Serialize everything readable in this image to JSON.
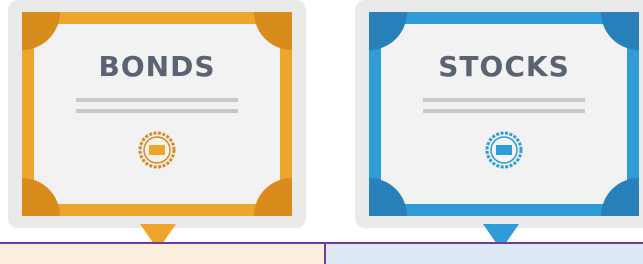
{
  "bonds": {
    "title": "BONDS",
    "colors": {
      "border": "#efa52b",
      "corner": "#d98c1c",
      "seal": "#d88a1f",
      "seal_fill": "#efa52b",
      "panel": "#fbeedc"
    }
  },
  "stocks": {
    "title": "STOCKS",
    "colors": {
      "border": "#2f9bd8",
      "corner": "#2780ba",
      "seal": "#2f9bd8",
      "seal_fill": "#2f9bd8",
      "panel": "#dfe9f6"
    }
  },
  "divider_color": "#6b3f9e"
}
